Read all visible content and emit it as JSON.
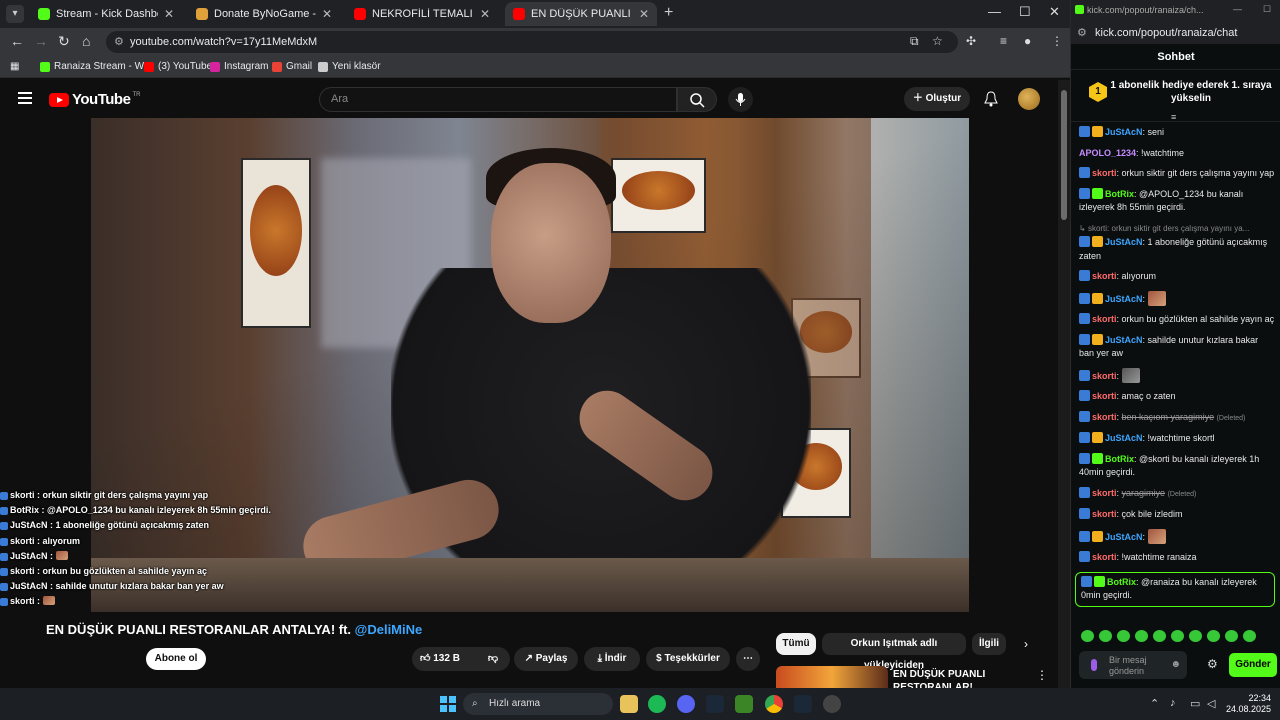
{
  "browser": {
    "tabs": [
      {
        "title": "Stream - Kick Dashboard",
        "favicon_color": "#53fc18",
        "active": false
      },
      {
        "title": "Donate ByNoGame - Gelen/Gi",
        "favicon_color": "#e0a13a",
        "active": false
      },
      {
        "title": "NEKROFİLİ TEMALI JAPON KO",
        "favicon_color": "#ff0000",
        "active": false
      },
      {
        "title": "EN DÜŞÜK PUANLI RESTORA",
        "favicon_color": "#ff0000",
        "active": true
      }
    ],
    "url": "youtube.com/watch?v=17y11MeMdxM",
    "bookmarks": [
      {
        "label": "Ranaiza Stream - W...",
        "icon": "kick-icon",
        "color": "#53fc18"
      },
      {
        "label": "(3) YouTube",
        "icon": "youtube-icon",
        "color": "#ff0000"
      },
      {
        "label": "Instagram",
        "icon": "instagram-icon",
        "color": "#d6249f"
      },
      {
        "label": "Gmail",
        "icon": "gmail-icon",
        "color": "#ea4335"
      },
      {
        "label": "Yeni klasör",
        "icon": "folder-icon",
        "color": "#cccccc"
      }
    ]
  },
  "youtube": {
    "logo": "YouTube",
    "logo_country": "TR",
    "search_placeholder": "Ara",
    "create_label": "Oluştur",
    "video_title": "EN DÜŞÜK PUANLI RESTORANLAR ANTALYA! ft.",
    "video_title_mention": "@DeliMiNe",
    "channel_subs": "Abone ol",
    "likes": "132 B",
    "share_label": "Paylaş",
    "download_label": "İndir",
    "thanks_label": "Teşekkürler",
    "chips": [
      "Tümü",
      "Orkun Işıtmak adlı yükleyiciden",
      "İlgili"
    ],
    "recommended_title": "EN DÜŞÜK PUANLI RESTORANLAR!"
  },
  "overlay_chat": [
    {
      "user": "skorti",
      "text": "orkun siktir git ders çalışma yayını yap"
    },
    {
      "user": "BotRix",
      "text": "@APOLO_1234 bu kanalı izleyerek 8h 55min geçirdi."
    },
    {
      "user": "JuStAcN",
      "text": "1 aboneliğe götünü açıcakmış zaten"
    },
    {
      "user": "skorti",
      "text": "alıyorum"
    },
    {
      "user": "JuStAcN",
      "text": ""
    },
    {
      "user": "skorti",
      "text": "orkun bu gözlükten al sahilde yayın aç"
    },
    {
      "user": "JuStAcN",
      "text": "sahilde unutur kızlara bakar ban yer aw"
    },
    {
      "user": "skorti",
      "text": ""
    },
    {
      "user": "skorti",
      "text": "amaç o zaten"
    },
    {
      "user": "JuStAcN",
      "text": "!watchtime skortl"
    },
    {
      "user": "BotRix",
      "text": "@skorti bu kanalı izleyerek 1h 40min geçirdi."
    },
    {
      "user": "skorti",
      "text": "çok bile izledim"
    },
    {
      "user": "JuStAcN",
      "text": ""
    },
    {
      "user": "skorti",
      "text": "!watchtime ranaiza"
    },
    {
      "user": "BotRix",
      "text": "@ranaiza bu kanalı izleyerek 0min geçirdi."
    }
  ],
  "chat": {
    "url": "kick.com/popout/ranaiza/chat",
    "window_title": "kick.com/popout/ranaiza/ch...",
    "header": "Sohbet",
    "goal_text": "1 abonelik hediye ederek 1. sıraya yükselin",
    "goal_rank": "1",
    "messages": [
      {
        "user": "JuStAcN",
        "badges": [
          "mod",
          "sub"
        ],
        "text": "seni",
        "color": "#3ea6ff"
      },
      {
        "user": "APOLO_1234",
        "badges": [],
        "text": "!watchtime",
        "color": "#c58cff"
      },
      {
        "user": "skorti",
        "badges": [
          "mod"
        ],
        "text": "orkun siktir git ders çalışma yayını yap",
        "color": "#ff6b6b"
      },
      {
        "user": "BotRix",
        "badges": [
          "mod",
          "bot"
        ],
        "text": "@APOLO_1234 bu kanalı izleyerek 8h 55min geçirdi.",
        "color": "#53fc18"
      },
      {
        "reply": "skorti: orkun siktir git ders çalışma yayını ya..."
      },
      {
        "user": "JuStAcN",
        "badges": [
          "mod",
          "sub"
        ],
        "text": "1 aboneliğe götünü açıcakmış zaten",
        "color": "#3ea6ff"
      },
      {
        "user": "skorti",
        "badges": [
          "mod"
        ],
        "text": "alıyorum",
        "color": "#ff6b6b"
      },
      {
        "user": "JuStAcN",
        "badges": [
          "mod",
          "sub"
        ],
        "text": "",
        "emote": "emote-face",
        "color": "#3ea6ff"
      },
      {
        "user": "skorti",
        "badges": [
          "mod"
        ],
        "text": "orkun bu gözlükten al sahilde yayın aç",
        "color": "#ff6b6b"
      },
      {
        "user": "JuStAcN",
        "badges": [
          "mod",
          "sub"
        ],
        "text": "sahilde unutur kızlara bakar ban yer aw",
        "color": "#3ea6ff"
      },
      {
        "user": "skorti",
        "badges": [
          "mod"
        ],
        "text": "",
        "emote": "emote-gray",
        "color": "#ff6b6b"
      },
      {
        "user": "skorti",
        "badges": [
          "mod"
        ],
        "text": "amaç o zaten",
        "color": "#ff6b6b"
      },
      {
        "user": "skorti",
        "badges": [
          "mod"
        ],
        "text": "ben kaçıom yaragimiye",
        "deleted": "(Deleted)",
        "color": "#ff6b6b"
      },
      {
        "user": "JuStAcN",
        "badges": [
          "mod",
          "sub"
        ],
        "text": "!watchtime skortl",
        "color": "#3ea6ff"
      },
      {
        "user": "BotRix",
        "badges": [
          "mod",
          "bot"
        ],
        "text": "@skorti bu kanalı izleyerek 1h 40min geçirdi.",
        "color": "#53fc18"
      },
      {
        "user": "skorti",
        "badges": [
          "mod"
        ],
        "text": "yaragimiye",
        "deleted": "(Deleted)",
        "color": "#ff6b6b"
      },
      {
        "user": "skorti",
        "badges": [
          "mod"
        ],
        "text": "çok bile izledim",
        "color": "#ff6b6b"
      },
      {
        "user": "JuStAcN",
        "badges": [
          "mod",
          "sub"
        ],
        "text": "",
        "emote": "emote-face",
        "color": "#3ea6ff"
      },
      {
        "user": "skorti",
        "badges": [
          "mod"
        ],
        "text": "!watchtime ranaiza",
        "color": "#ff6b6b"
      },
      {
        "user": "BotRix",
        "badges": [
          "mod",
          "bot"
        ],
        "text": "@ranaiza bu kanalı izleyerek 0min geçirdi.",
        "color": "#53fc18",
        "highlight": true
      }
    ],
    "input_placeholder": "Bir mesaj gönderin",
    "send_label": "Gönder"
  },
  "taskbar": {
    "search_placeholder": "Hızlı arama",
    "time": "22:34",
    "date": "24.08.2025"
  }
}
